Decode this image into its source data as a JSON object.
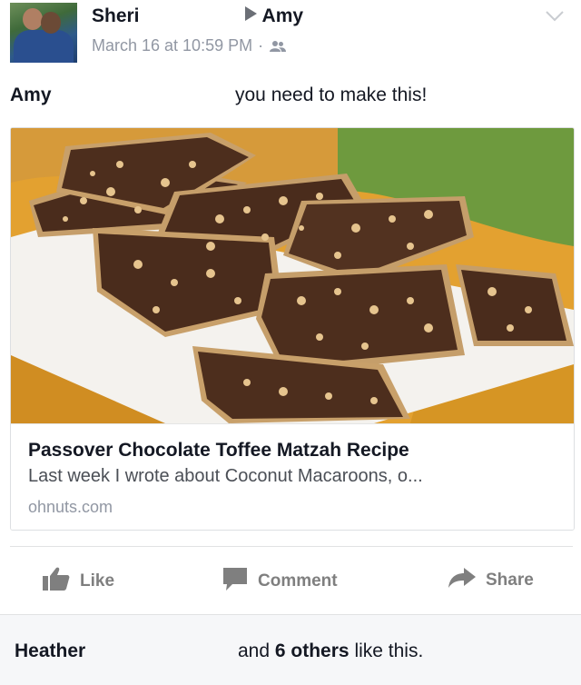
{
  "post": {
    "author": "Sheri",
    "target": "Amy",
    "timestamp": "March 16 at 10:59 PM",
    "separator": "·",
    "audience_icon": "friends-icon",
    "menu_icon": "chevron-down-icon"
  },
  "message": {
    "mention": "Amy",
    "text": "you need to make this!"
  },
  "link_card": {
    "title": "Passover Chocolate Toffee Matzah Recipe",
    "description": "Last week I wrote about Coconut Macaroons, o...",
    "domain": "ohnuts.com"
  },
  "actions": {
    "like": "Like",
    "comment": "Comment",
    "share": "Share"
  },
  "likes": {
    "first_name": "Heather",
    "and": "and",
    "count_label": "6 others",
    "suffix": "like this."
  }
}
